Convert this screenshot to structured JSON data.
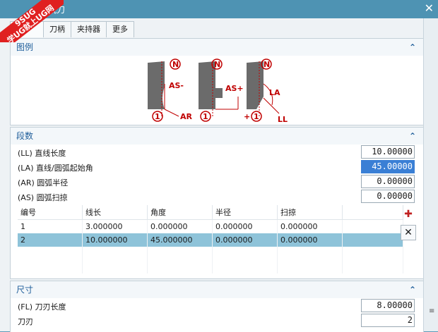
{
  "window": {
    "title": "的铣刀",
    "close_symbol": "✕"
  },
  "watermark": {
    "line1": "9SUG",
    "line2": "学UG就上UG网"
  },
  "tabs": [
    {
      "label": ""
    },
    {
      "label": "刀柄"
    },
    {
      "label": "夹持器"
    },
    {
      "label": "更多"
    }
  ],
  "legend": {
    "header": "图例",
    "diagram_labels": {
      "n": "N",
      "one": "1",
      "as_minus": "AS-",
      "as_plus": "AS+",
      "ar": "AR",
      "la": "LA",
      "ll": "LL",
      "plus": "+"
    }
  },
  "segments": {
    "header": "段数",
    "fields": [
      {
        "label": "(LL) 直线长度",
        "value": "10.00000"
      },
      {
        "label": "(LA) 直线/圆弧起始角",
        "value": "45.00000"
      },
      {
        "label": "(AR) 圆弧半径",
        "value": "0.00000"
      },
      {
        "label": "(AS) 圆弧扫掠",
        "value": "0.00000"
      }
    ],
    "table": {
      "columns": [
        "编号",
        "线长",
        "角度",
        "半径",
        "扫掠"
      ],
      "rows": [
        [
          "1",
          "3.000000",
          "0.000000",
          "0.000000",
          "0.000000"
        ],
        [
          "2",
          "10.000000",
          "45.000000",
          "0.000000",
          "0.000000"
        ]
      ]
    },
    "add_icon": "✚",
    "delete_icon": "✕"
  },
  "dimensions": {
    "header": "尺寸",
    "fields": [
      {
        "label": "(FL) 刀刃长度",
        "value": "8.00000"
      },
      {
        "label": "刀刃",
        "value": "2"
      }
    ]
  },
  "section_chevron": "⌃",
  "scroll_grip": "≡",
  "colors": {
    "titlebar": "#4e93b3",
    "section_header_text": "#1f5e9a",
    "selected_row": "#8ec3d9",
    "selected_input": "#3a7fd5",
    "diagram_red": "#c00000"
  }
}
